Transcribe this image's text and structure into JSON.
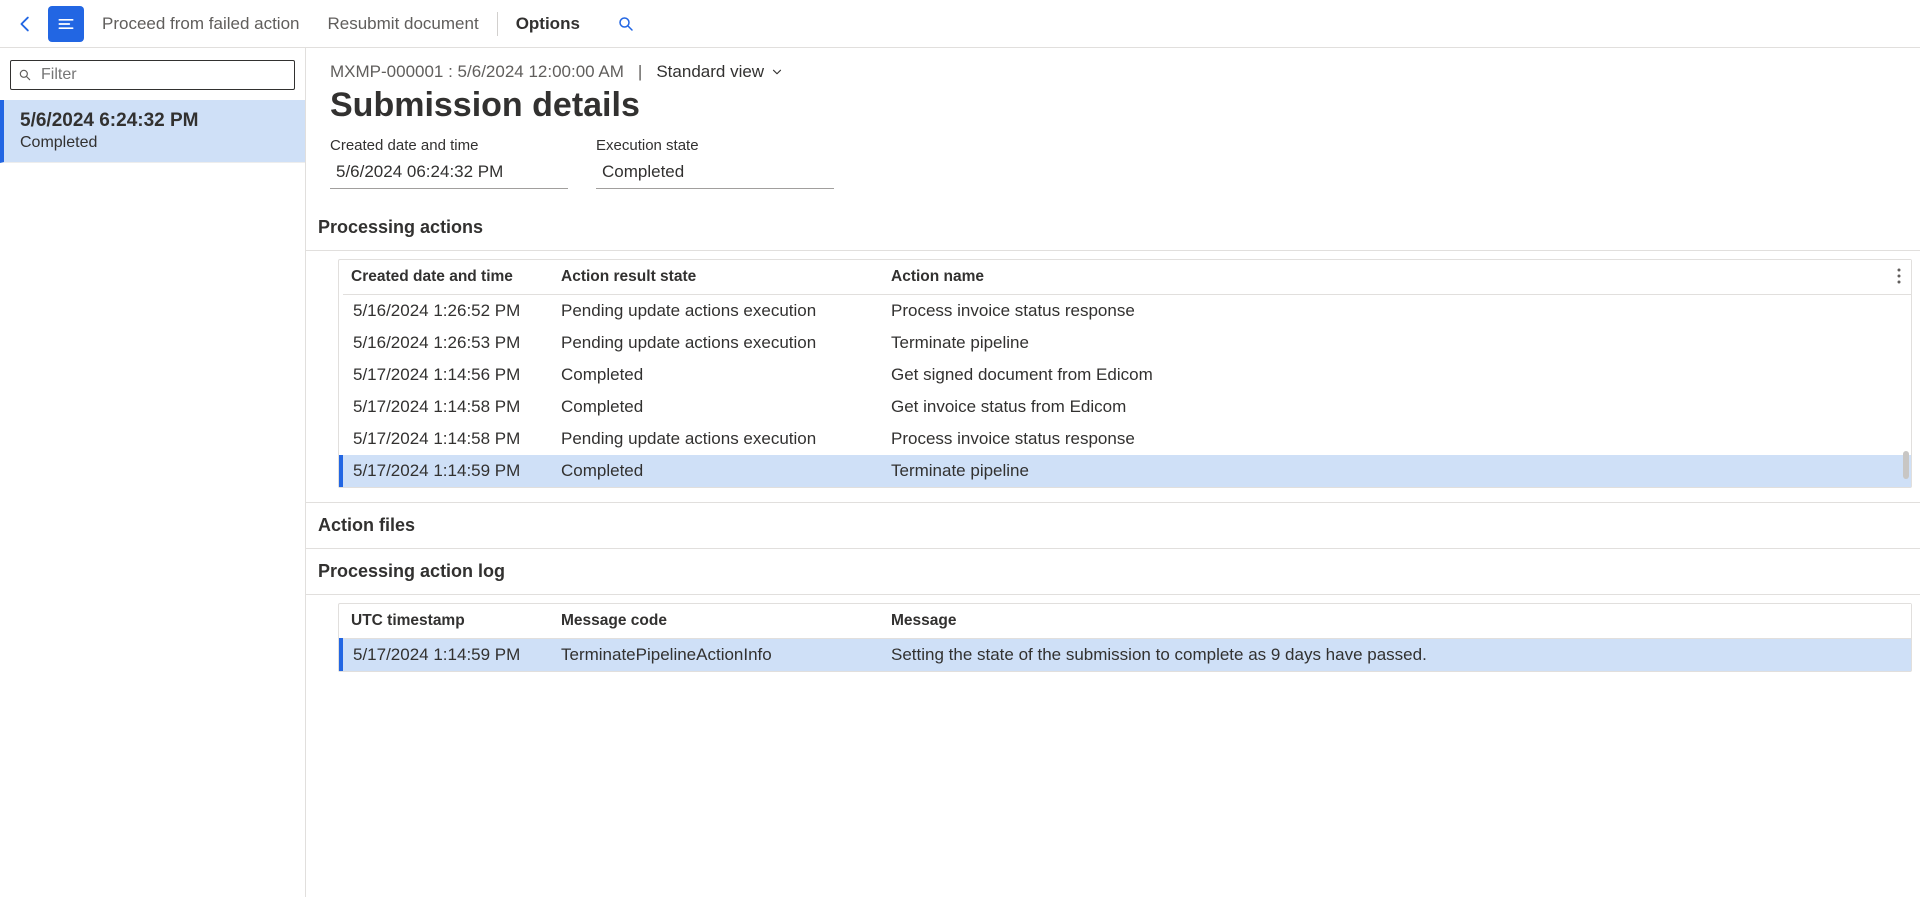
{
  "toolbar": {
    "commands": [
      {
        "label": "Proceed from failed action",
        "active": false
      },
      {
        "label": "Resubmit document",
        "active": false
      },
      {
        "label": "Options",
        "active": true
      }
    ]
  },
  "sidebar": {
    "filter_placeholder": "Filter",
    "items": [
      {
        "title": "5/6/2024 6:24:32 PM",
        "sub": "Completed",
        "selected": true
      }
    ]
  },
  "header": {
    "record_id": "MXMP-000001 : 5/6/2024 12:00:00 AM",
    "view_label": "Standard view",
    "page_title": "Submission details"
  },
  "fields": {
    "created_label": "Created date and time",
    "created_value": "5/6/2024 06:24:32 PM",
    "state_label": "Execution state",
    "state_value": "Completed"
  },
  "processing_actions": {
    "title": "Processing actions",
    "columns": {
      "date": "Created date and time",
      "state": "Action result state",
      "name": "Action name"
    },
    "rows": [
      {
        "date": "5/16/2024 1:26:52 PM",
        "state": "Pending update actions execution",
        "name": "Process invoice status response",
        "selected": false
      },
      {
        "date": "5/16/2024 1:26:53 PM",
        "state": "Pending update actions execution",
        "name": "Terminate pipeline",
        "selected": false
      },
      {
        "date": "5/17/2024 1:14:56 PM",
        "state": "Completed",
        "name": "Get signed document from Edicom",
        "selected": false
      },
      {
        "date": "5/17/2024 1:14:58 PM",
        "state": "Completed",
        "name": "Get invoice status from Edicom",
        "selected": false
      },
      {
        "date": "5/17/2024 1:14:58 PM",
        "state": "Pending update actions execution",
        "name": "Process invoice status response",
        "selected": false
      },
      {
        "date": "5/17/2024 1:14:59 PM",
        "state": "Completed",
        "name": "Terminate pipeline",
        "selected": true
      }
    ]
  },
  "action_files": {
    "title": "Action files"
  },
  "processing_log": {
    "title": "Processing action log",
    "columns": {
      "ts": "UTC timestamp",
      "code": "Message code",
      "msg": "Message"
    },
    "rows": [
      {
        "ts": "5/17/2024 1:14:59 PM",
        "code": "TerminatePipelineActionInfo",
        "msg": "Setting the state of the submission to complete as 9 days have passed.",
        "selected": true
      }
    ]
  }
}
